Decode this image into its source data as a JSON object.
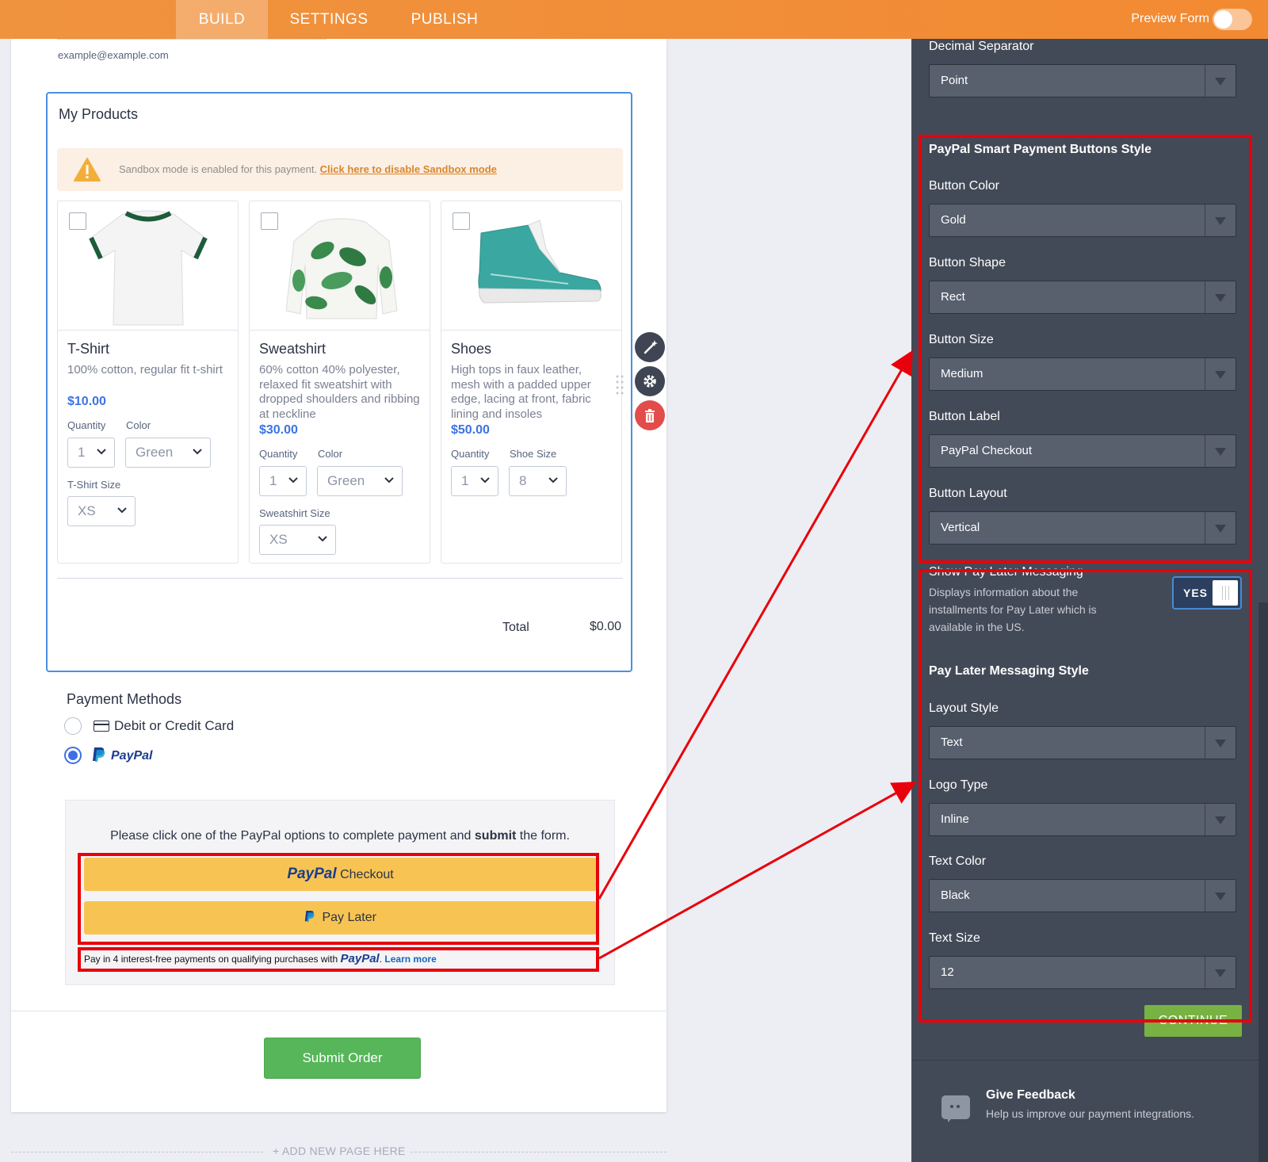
{
  "topbar": {
    "tabs": [
      "BUILD",
      "SETTINGS",
      "PUBLISH"
    ],
    "preview_label": "Preview Form"
  },
  "form": {
    "email_hint": "example@example.com",
    "products": {
      "title": "My Products",
      "sandbox_msg": "Sandbox mode is enabled for this payment.",
      "sandbox_link": "Click here to disable Sandbox mode",
      "items": [
        {
          "name": "T-Shirt",
          "description": "100% cotton, regular fit t-shirt",
          "price": "$10.00",
          "quantity_label": "Quantity",
          "quantity_value": "1",
          "option_label": "Color",
          "option_value": "Green",
          "size_label": "T-Shirt Size",
          "size_value": "XS"
        },
        {
          "name": "Sweatshirt",
          "description": "60% cotton 40% polyester, relaxed fit sweatshirt with dropped shoulders and ribbing at neckline",
          "price": "$30.00",
          "quantity_label": "Quantity",
          "quantity_value": "1",
          "option_label": "Color",
          "option_value": "Green",
          "size_label": "Sweatshirt Size",
          "size_value": "XS"
        },
        {
          "name": "Shoes",
          "description": "High tops in faux leather, mesh with a padded upper edge, lacing at front, fabric lining and insoles",
          "price": "$50.00",
          "quantity_label": "Quantity",
          "quantity_value": "1",
          "option_label": "Shoe Size",
          "option_value": "8"
        }
      ],
      "total_label": "Total",
      "total_value": "$0.00"
    },
    "payment": {
      "title": "Payment Methods",
      "card_label": "Debit or Credit Card",
      "paypal_label": "PayPal",
      "instruction_prefix": "Please click one of the PayPal options to complete payment and ",
      "instruction_bold": "submit",
      "instruction_suffix": " the form.",
      "checkout_brand": "PayPal",
      "checkout_text": "Checkout",
      "paylater_text": "Pay Later",
      "message_text": "Pay in 4 interest-free payments on qualifying purchases with",
      "message_brand": "PayPal",
      "message_link": "Learn more"
    },
    "submit_label": "Submit Order",
    "add_page_label": "+ ADD NEW PAGE HERE"
  },
  "panel": {
    "decimal_label": "Decimal Separator",
    "decimal_value": "Point",
    "smart_section": "PayPal Smart Payment Buttons Style",
    "button_color_label": "Button Color",
    "button_color_value": "Gold",
    "button_shape_label": "Button Shape",
    "button_shape_value": "Rect",
    "button_size_label": "Button Size",
    "button_size_value": "Medium",
    "button_label_label": "Button Label",
    "button_label_value": "PayPal Checkout",
    "button_layout_label": "Button Layout",
    "button_layout_value": "Vertical",
    "pay_later_label": "Show Pay Later Messaging",
    "pay_later_desc": "Displays information about the installments for Pay Later which is available in the US.",
    "pay_later_toggle": "YES",
    "messaging_section": "Pay Later Messaging Style",
    "layout_style_label": "Layout Style",
    "layout_style_value": "Text",
    "logo_type_label": "Logo Type",
    "logo_type_value": "Inline",
    "text_color_label": "Text Color",
    "text_color_value": "Black",
    "text_size_label": "Text Size",
    "text_size_value": "12",
    "continue_label": "CONTINUE",
    "feedback_title": "Give Feedback",
    "feedback_sub": "Help us improve our payment integrations."
  },
  "colors": {
    "topbar": "#f28a32",
    "panel_bg": "#434a57",
    "accent_blue": "#3b73e4",
    "annotation_red": "#e8000b",
    "paypal_gold": "#f7c454",
    "submit_green": "#56b659",
    "continue_green": "#78b243"
  }
}
